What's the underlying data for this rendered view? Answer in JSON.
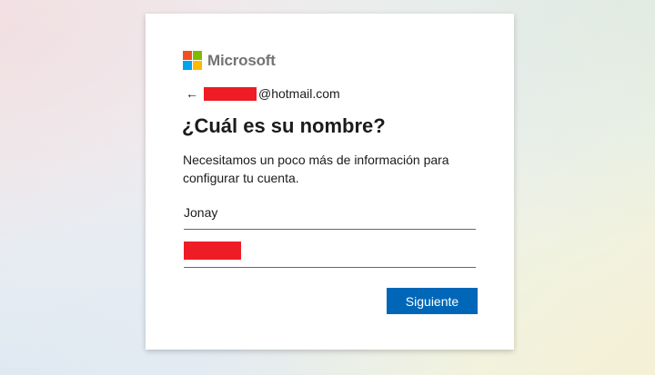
{
  "brand": {
    "name": "Microsoft",
    "logo_colors": [
      "#f25022",
      "#7fba00",
      "#00a4ef",
      "#ffb900"
    ]
  },
  "identity": {
    "email_suffix": "@hotmail.com",
    "back_icon": "back-arrow-icon",
    "redaction_color": "#ee1c25"
  },
  "page": {
    "title": "¿Cuál es su nombre?",
    "description": "Necesitamos un poco más de información para configurar tu cuenta."
  },
  "form": {
    "first_name_value": "Jonay",
    "last_name_value": ""
  },
  "actions": {
    "next_label": "Siguiente",
    "next_color": "#0067b8"
  }
}
